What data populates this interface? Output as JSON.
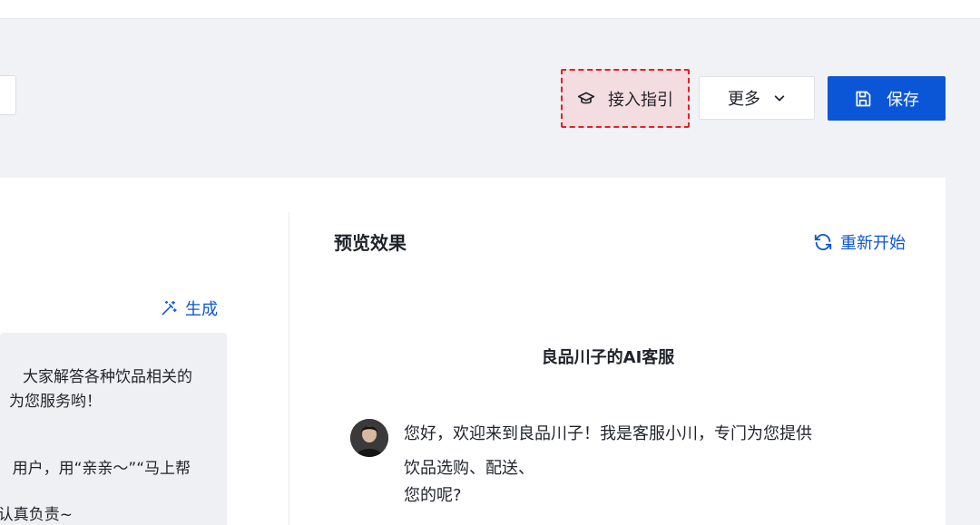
{
  "toolbar": {
    "guide_label": "接入指引",
    "more_label": "更多",
    "save_label": "保存"
  },
  "left_panel": {
    "generate_label": "生成",
    "prompt_lines": [
      "大家解答各种饮品相关的",
      "为您服务哟！",
      "用户，用“亲亲～”“马上帮",
      "认真负责~"
    ]
  },
  "preview": {
    "title": "预览效果",
    "restart_label": "重新开始",
    "bot_name": "良品川子的AI客服",
    "message_lines": [
      "您好，欢迎来到良品川子！我是客服小川，专门为您提供",
      "饮品选购、配送、",
      "您的呢?"
    ]
  },
  "icons": {
    "guide": "graduation-cap-icon",
    "more": "chevron-down-icon",
    "save": "save-icon",
    "generate": "magic-wand-icon",
    "restart": "refresh-icon"
  },
  "colors": {
    "primary": "#0a56d6",
    "highlight_border": "#e0202a",
    "highlight_fill": "#f4dde0",
    "page_bg": "#f1f2f5"
  }
}
